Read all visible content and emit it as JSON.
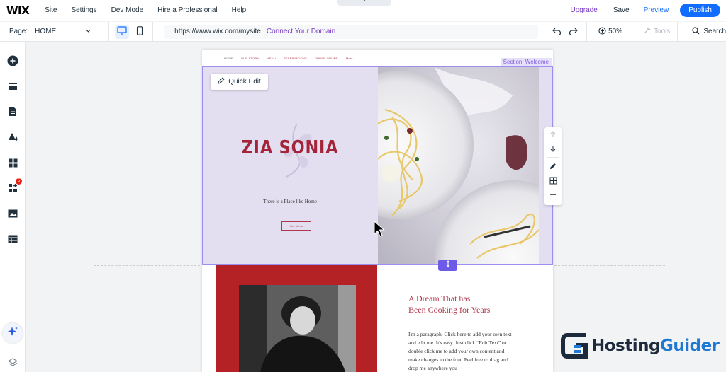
{
  "app": {
    "logo": "WIX"
  },
  "menu": {
    "items": [
      "Site",
      "Settings",
      "Dev Mode",
      "Hire a Professional",
      "Help"
    ]
  },
  "topbar": {
    "upgrade": "Upgrade",
    "save": "Save",
    "preview": "Preview",
    "publish": "Publish",
    "handle_glyph": "⌃"
  },
  "toolbar": {
    "page_label": "Page:",
    "page_value": "HOME",
    "url": "https://www.wix.com/mysite",
    "connect": "Connect Your Domain",
    "zoom": "50%",
    "tools": "Tools",
    "search": "Search"
  },
  "sidebar": {
    "badge": "5"
  },
  "site": {
    "nav": [
      "HOME",
      "OUR STORY",
      "MENU",
      "RESERVATIONS",
      "ORDER ONLINE",
      "More"
    ],
    "section_label": "Section: Welcome",
    "quick_edit": "Quick Edit",
    "title": "ZIA SONIA",
    "tagline": "There is a Place like Home",
    "see_menu": "See Menu",
    "heading_line1": "A Dream That has",
    "heading_line2": "Been Cooking for Years",
    "paragraph": "I'm a paragraph. Click here to add your own text and edit me. It's easy. Just click “Edit Text” or double click me to add your own content and make changes to the font. Feel free to drag and drop me anywhere you"
  },
  "watermark": {
    "text_part1": "Hosting",
    "text_part2": "Guider",
    "color1": "#1d2a3c",
    "color2": "#1f78d1"
  },
  "colors": {
    "accent": "#116dff",
    "brand_red": "#a4243a",
    "section_purple": "#6d5ae6",
    "upgrade_purple": "#7a3cc4"
  }
}
